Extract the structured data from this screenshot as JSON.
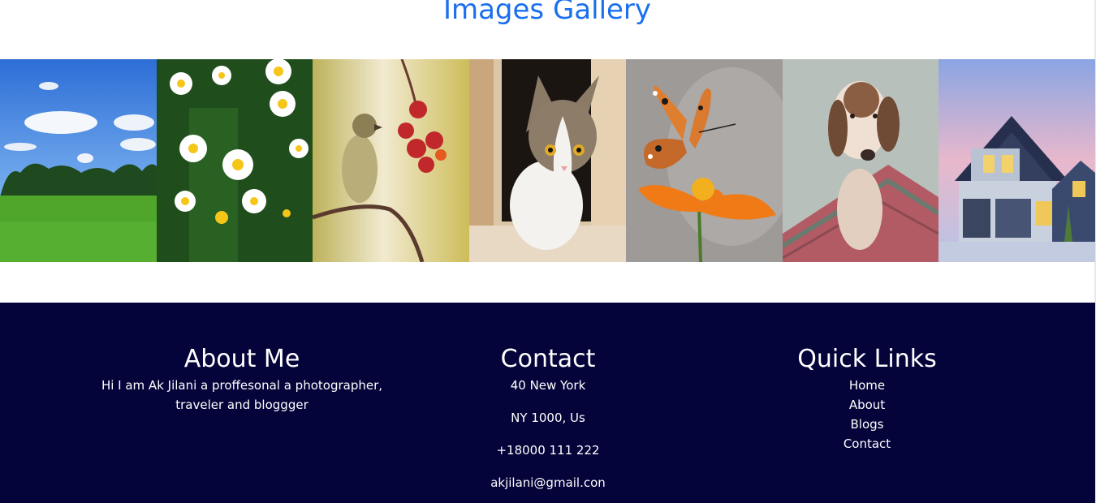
{
  "gallery": {
    "title": "Images Gallery",
    "images": [
      {
        "name": "landscape"
      },
      {
        "name": "daisies"
      },
      {
        "name": "bird"
      },
      {
        "name": "cat"
      },
      {
        "name": "butterfly"
      },
      {
        "name": "dog"
      },
      {
        "name": "house"
      }
    ]
  },
  "footer": {
    "about": {
      "heading": "About Me",
      "text": "Hi I am Ak Jilani a proffesonal a photographer, traveler and bloggger"
    },
    "contact": {
      "heading": "Contact",
      "address": "40 New York",
      "city": "NY 1000, Us",
      "phone": "+18000 111 222",
      "email": "akjilani@gmail.con"
    },
    "links": {
      "heading": "Quick Links",
      "items": [
        "Home",
        "About",
        "Blogs",
        "Contact"
      ]
    }
  }
}
